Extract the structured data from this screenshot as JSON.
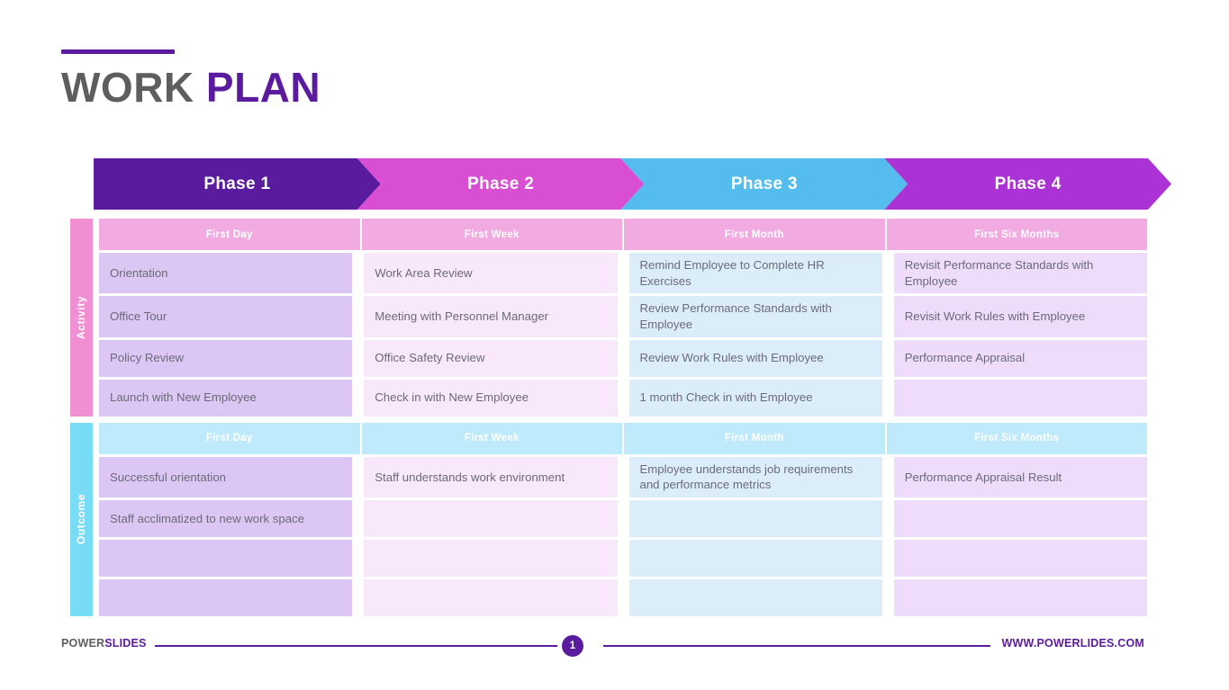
{
  "title": {
    "word1": "WORK",
    "word2": "PLAN"
  },
  "phases": [
    {
      "label": "Phase 1",
      "color": "#5b1b9e"
    },
    {
      "label": "Phase 2",
      "color": "#d94fd4"
    },
    {
      "label": "Phase 3",
      "color": "#55bdee"
    },
    {
      "label": "Phase 4",
      "color": "#ab33d6"
    }
  ],
  "sections": [
    {
      "label": "Activity",
      "label_color": "#f08fd2",
      "header_color": "#f2abe0",
      "headers": [
        "First Day",
        "First Week",
        "First Month",
        "First Six Months"
      ],
      "rows": [
        [
          "Orientation",
          "Work Area Review",
          "Remind Employee to Complete HR Exercises",
          "Revisit Performance Standards with Employee"
        ],
        [
          "Office Tour",
          "Meeting with Personnel Manager",
          "Review Performance Standards with Employee",
          "Revisit Work Rules with Employee"
        ],
        [
          "Policy Review",
          "Office Safety Review",
          "Review Work Rules with Employee",
          "Performance Appraisal"
        ],
        [
          "Launch with New Employee",
          "Check in with New Employee",
          "1 month Check in with Employee",
          ""
        ]
      ]
    },
    {
      "label": "Outcome",
      "label_color": "#78dcf5",
      "header_color": "#bfeafb",
      "headers": [
        "First Day",
        "First Week",
        "First Month",
        "First Six Months"
      ],
      "rows": [
        [
          "Successful orientation",
          "Staff understands work environment",
          "Employee understands job requirements and performance metrics",
          "Performance Appraisal Result"
        ],
        [
          "Staff acclimatized to new work space",
          "",
          "",
          ""
        ],
        [
          "",
          "",
          "",
          ""
        ],
        [
          "",
          "",
          "",
          ""
        ]
      ]
    }
  ],
  "footer": {
    "brand_part1": "POWER",
    "brand_part2": "SLIDES",
    "page_number": "1",
    "url": "WWW.POWERLIDES.COM"
  }
}
